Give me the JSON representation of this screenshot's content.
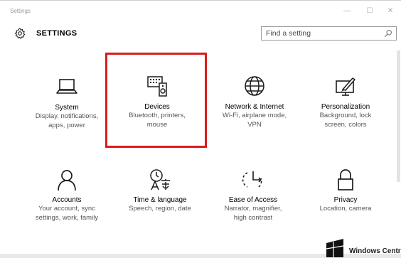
{
  "window": {
    "title": "Settings",
    "minimize_glyph": "—",
    "maximize_glyph": "☐",
    "close_glyph": "✕"
  },
  "header": {
    "title": "SETTINGS",
    "icon": "gear-icon"
  },
  "search": {
    "placeholder": "Find a setting",
    "icon": "search-icon"
  },
  "tiles": [
    {
      "name": "System",
      "desc": [
        "Display, notifications,",
        "apps, power"
      ],
      "icon": "laptop-icon"
    },
    {
      "name": "Devices",
      "desc": [
        "Bluetooth, printers,",
        "mouse"
      ],
      "icon": "devices-icon",
      "highlighted": true
    },
    {
      "name": "Network & Internet",
      "desc": [
        "Wi-Fi, airplane mode,",
        "VPN"
      ],
      "icon": "globe-icon"
    },
    {
      "name": "Personalization",
      "desc": [
        "Background, lock",
        "screen, colors"
      ],
      "icon": "paint-screen-icon"
    },
    {
      "name": "Accounts",
      "desc": [
        "Your account, sync",
        "settings, work, family"
      ],
      "icon": "person-icon"
    },
    {
      "name": "Time & language",
      "desc": [
        "Speech, region, date"
      ],
      "icon": "time-language-icon"
    },
    {
      "name": "Ease of Access",
      "desc": [
        "Narrator, magnifier,",
        "high contrast"
      ],
      "icon": "ease-of-access-icon"
    },
    {
      "name": "Privacy",
      "desc": [
        "Location, camera"
      ],
      "icon": "lock-icon"
    }
  ],
  "colors": {
    "accent": "#1c1c1c",
    "highlight_border": "#d91c1c",
    "secondary_text": "#555555"
  },
  "watermark": {
    "text": "Windows Centra"
  }
}
